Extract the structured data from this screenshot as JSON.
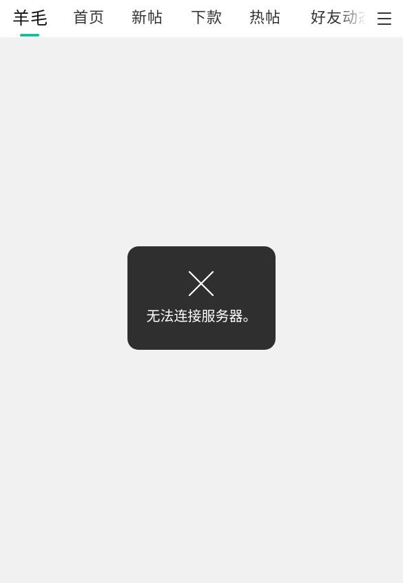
{
  "tabs": [
    {
      "label": "羊毛",
      "active": true
    },
    {
      "label": "首页",
      "active": false
    },
    {
      "label": "新帖",
      "active": false
    },
    {
      "label": "下款",
      "active": false
    },
    {
      "label": "热帖",
      "active": false
    },
    {
      "label": "好友动态",
      "active": false
    }
  ],
  "menu": {
    "icon": "hamburger-menu-icon"
  },
  "toast": {
    "icon": "close-x-icon",
    "message": "无法连接服务器。"
  },
  "colors": {
    "accent": "#2bb59a",
    "background": "#f1f1f1",
    "toast_bg": "#2f2f2f"
  }
}
